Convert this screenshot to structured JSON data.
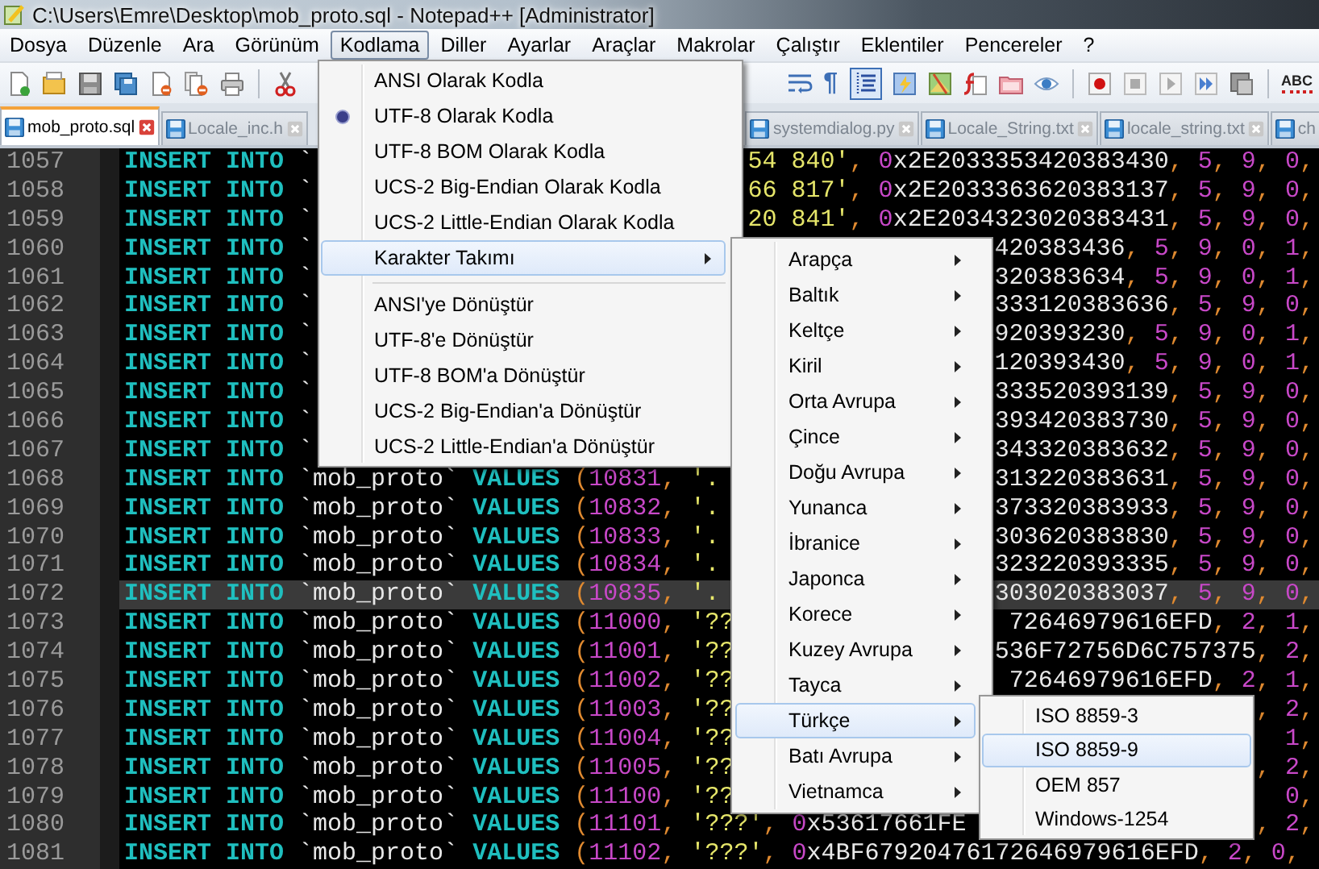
{
  "window": {
    "title": "C:\\Users\\Emre\\Desktop\\mob_proto.sql - Notepad++ [Administrator]"
  },
  "menu_bar": [
    {
      "label": "Dosya",
      "selected": false
    },
    {
      "label": "Düzenle",
      "selected": false
    },
    {
      "label": "Ara",
      "selected": false
    },
    {
      "label": "Görünüm",
      "selected": false
    },
    {
      "label": "Kodlama",
      "selected": true
    },
    {
      "label": "Diller",
      "selected": false
    },
    {
      "label": "Ayarlar",
      "selected": false
    },
    {
      "label": "Araçlar",
      "selected": false
    },
    {
      "label": "Makrolar",
      "selected": false
    },
    {
      "label": "Çalıştır",
      "selected": false
    },
    {
      "label": "Eklentiler",
      "selected": false
    },
    {
      "label": "Pencereler",
      "selected": false
    },
    {
      "label": "?",
      "selected": false
    }
  ],
  "toolbar": {
    "show_all_characters": {
      "glyph": "¶"
    },
    "indent_guide": {
      "pressed": true
    },
    "spell_check": {
      "label": "ABC"
    }
  },
  "tabs_left": [
    {
      "label": "mob_proto.sql",
      "selected": true,
      "cut_off": false
    },
    {
      "label": "Locale_inc.h",
      "selected": false,
      "cut_off": false
    }
  ],
  "tabs_right": [
    {
      "label": "systemdialog.py",
      "selected": false,
      "cut_off": false
    },
    {
      "label": "Locale_String.txt",
      "selected": false,
      "cut_off": false
    },
    {
      "label": "locale_string.txt",
      "selected": false,
      "cut_off": false
    },
    {
      "label": "ch",
      "selected": false,
      "cut_off": true
    }
  ],
  "editor": {
    "lines": [
      {
        "number": "1057",
        "current": false,
        "left": [
          {
            "kind": "kw",
            "t": "INSERT INTO"
          },
          {
            "kind": "id",
            "t": " `"
          }
        ],
        "right": [
          {
            "kind": "str",
            "t": "54 840'"
          },
          {
            "kind": "list",
            "t": ", "
          },
          {
            "kind": "hex",
            "t": "0x2E2033353420383430"
          },
          {
            "kind": "list",
            "t": ", 5, 9, 0,"
          }
        ]
      },
      {
        "number": "1058",
        "current": false,
        "left": [
          {
            "kind": "kw",
            "t": "INSERT INTO"
          },
          {
            "kind": "id",
            "t": " `"
          }
        ],
        "right": [
          {
            "kind": "str",
            "t": "66 817'"
          },
          {
            "kind": "list",
            "t": ", "
          },
          {
            "kind": "hex",
            "t": "0x2E2033363620383137"
          },
          {
            "kind": "list",
            "t": ", 5, 9, 0,"
          }
        ]
      },
      {
        "number": "1059",
        "current": false,
        "left": [
          {
            "kind": "kw",
            "t": "INSERT INTO"
          },
          {
            "kind": "id",
            "t": " `"
          }
        ],
        "right": [
          {
            "kind": "str",
            "t": "20 841'"
          },
          {
            "kind": "list",
            "t": ", "
          },
          {
            "kind": "hex",
            "t": "0x2E2034323020383431"
          },
          {
            "kind": "list",
            "t": ", 5, 9, 0,"
          }
        ]
      },
      {
        "number": "1060",
        "current": false,
        "left": [
          {
            "kind": "kw",
            "t": "INSERT INTO"
          },
          {
            "kind": "id",
            "t": " `"
          }
        ],
        "right": [
          {
            "kind": "id",
            "t": "420383436"
          },
          {
            "kind": "list",
            "t": ", 5, 9, 0, 1,"
          }
        ]
      },
      {
        "number": "1061",
        "current": false,
        "left": [
          {
            "kind": "kw",
            "t": "INSERT INTO"
          },
          {
            "kind": "id",
            "t": " `"
          }
        ],
        "right": [
          {
            "kind": "id",
            "t": "320383634"
          },
          {
            "kind": "list",
            "t": ", 5, 9, 0, 1,"
          }
        ]
      },
      {
        "number": "1062",
        "current": false,
        "left": [
          {
            "kind": "kw",
            "t": "INSERT INTO"
          },
          {
            "kind": "id",
            "t": " `"
          }
        ],
        "right": [
          {
            "kind": "id",
            "t": "333120383636"
          },
          {
            "kind": "list",
            "t": ", 5, 9, 0,"
          }
        ]
      },
      {
        "number": "1063",
        "current": false,
        "left": [
          {
            "kind": "kw",
            "t": "INSERT INTO"
          },
          {
            "kind": "id",
            "t": " `"
          }
        ],
        "right": [
          {
            "kind": "id",
            "t": "920393230"
          },
          {
            "kind": "list",
            "t": ", 5, 9, 0, 1,"
          }
        ]
      },
      {
        "number": "1064",
        "current": false,
        "left": [
          {
            "kind": "kw",
            "t": "INSERT INTO"
          },
          {
            "kind": "id",
            "t": " `"
          }
        ],
        "right": [
          {
            "kind": "id",
            "t": "120393430"
          },
          {
            "kind": "list",
            "t": ", 5, 9, 0, 1,"
          }
        ]
      },
      {
        "number": "1065",
        "current": false,
        "left": [
          {
            "kind": "kw",
            "t": "INSERT INTO"
          },
          {
            "kind": "id",
            "t": " `"
          }
        ],
        "right": [
          {
            "kind": "id",
            "t": "333520393139"
          },
          {
            "kind": "list",
            "t": ", 5, 9, 0,"
          }
        ]
      },
      {
        "number": "1066",
        "current": false,
        "left": [
          {
            "kind": "kw",
            "t": "INSERT INTO"
          },
          {
            "kind": "id",
            "t": " `"
          }
        ],
        "right": [
          {
            "kind": "id",
            "t": "393420383730"
          },
          {
            "kind": "list",
            "t": ", 5, 9, 0,"
          }
        ]
      },
      {
        "number": "1067",
        "current": false,
        "left": [
          {
            "kind": "kw",
            "t": "INSERT INTO"
          },
          {
            "kind": "id",
            "t": " `"
          }
        ],
        "right": [
          {
            "kind": "id",
            "t": "343320383632"
          },
          {
            "kind": "list",
            "t": ", 5, 9, 0,"
          }
        ]
      },
      {
        "number": "1068",
        "current": false,
        "left": [
          {
            "kind": "kw",
            "t": "INSERT INTO"
          },
          {
            "kind": "id",
            "t": " `mob_proto` "
          },
          {
            "kind": "kw",
            "t": "VALUES"
          },
          {
            "kind": "list",
            "t": " (10831, "
          },
          {
            "kind": "str",
            "t": "'."
          }
        ],
        "right": [
          {
            "kind": "id",
            "t": "313220383631"
          },
          {
            "kind": "list",
            "t": ", 5, 9, 0,"
          }
        ]
      },
      {
        "number": "1069",
        "current": false,
        "left": [
          {
            "kind": "kw",
            "t": "INSERT INTO"
          },
          {
            "kind": "id",
            "t": " `mob_proto` "
          },
          {
            "kind": "kw",
            "t": "VALUES"
          },
          {
            "kind": "list",
            "t": " (10832, "
          },
          {
            "kind": "str",
            "t": "'."
          }
        ],
        "right": [
          {
            "kind": "id",
            "t": "373320383933"
          },
          {
            "kind": "list",
            "t": ", 5, 9, 0,"
          }
        ]
      },
      {
        "number": "1070",
        "current": false,
        "left": [
          {
            "kind": "kw",
            "t": "INSERT INTO"
          },
          {
            "kind": "id",
            "t": " `mob_proto` "
          },
          {
            "kind": "kw",
            "t": "VALUES"
          },
          {
            "kind": "list",
            "t": " (10833, "
          },
          {
            "kind": "str",
            "t": "'."
          }
        ],
        "right": [
          {
            "kind": "id",
            "t": "303620383830"
          },
          {
            "kind": "list",
            "t": ", 5, 9, 0,"
          }
        ]
      },
      {
        "number": "1071",
        "current": false,
        "left": [
          {
            "kind": "kw",
            "t": "INSERT INTO"
          },
          {
            "kind": "id",
            "t": " `mob_proto` "
          },
          {
            "kind": "kw",
            "t": "VALUES"
          },
          {
            "kind": "list",
            "t": " (10834, "
          },
          {
            "kind": "str",
            "t": "'."
          }
        ],
        "right": [
          {
            "kind": "id",
            "t": "323220393335"
          },
          {
            "kind": "list",
            "t": ", 5, 9, 0,"
          }
        ]
      },
      {
        "number": "1072",
        "current": true,
        "left": [
          {
            "kind": "kw",
            "t": "INSERT INTO"
          },
          {
            "kind": "id",
            "t": " `mob_proto` "
          },
          {
            "kind": "kw",
            "t": "VALUES"
          },
          {
            "kind": "list",
            "t": " (10835, "
          },
          {
            "kind": "str",
            "t": "'."
          }
        ],
        "right": [
          {
            "kind": "id",
            "t": "303020383037"
          },
          {
            "kind": "list",
            "t": ", 5, 9, 0,"
          }
        ]
      },
      {
        "number": "1073",
        "current": false,
        "left": [
          {
            "kind": "kw",
            "t": "INSERT INTO"
          },
          {
            "kind": "id",
            "t": " `mob_proto` "
          },
          {
            "kind": "kw",
            "t": "VALUES"
          },
          {
            "kind": "list",
            "t": " (11000, "
          },
          {
            "kind": "str",
            "t": "'??"
          }
        ],
        "right": [
          {
            "kind": "id",
            "t": "72646979616EFD"
          },
          {
            "kind": "list",
            "t": ", 2, 1,"
          }
        ]
      },
      {
        "number": "1074",
        "current": false,
        "left": [
          {
            "kind": "kw",
            "t": "INSERT INTO"
          },
          {
            "kind": "id",
            "t": " `mob_proto` "
          },
          {
            "kind": "kw",
            "t": "VALUES"
          },
          {
            "kind": "list",
            "t": " (11001, "
          },
          {
            "kind": "str",
            "t": "'??"
          }
        ],
        "right": [
          {
            "kind": "id",
            "t": "536F72756D6C757375"
          },
          {
            "kind": "list",
            "t": ", 2,"
          }
        ]
      },
      {
        "number": "1075",
        "current": false,
        "left": [
          {
            "kind": "kw",
            "t": "INSERT INTO"
          },
          {
            "kind": "id",
            "t": " `mob_proto` "
          },
          {
            "kind": "kw",
            "t": "VALUES"
          },
          {
            "kind": "list",
            "t": " (11002, "
          },
          {
            "kind": "str",
            "t": "'??"
          }
        ],
        "right": [
          {
            "kind": "id",
            "t": "72646979616EFD"
          },
          {
            "kind": "list",
            "t": ", 2, 1,"
          }
        ]
      },
      {
        "number": "1076",
        "current": false,
        "left": [
          {
            "kind": "kw",
            "t": "INSERT INTO"
          },
          {
            "kind": "id",
            "t": " `mob_proto` "
          },
          {
            "kind": "kw",
            "t": "VALUES"
          },
          {
            "kind": "list",
            "t": " (11003, "
          },
          {
            "kind": "str",
            "t": "'??"
          }
        ],
        "right": [
          {
            "kind": "list",
            "t": ", 2,"
          }
        ]
      },
      {
        "number": "1077",
        "current": false,
        "left": [
          {
            "kind": "kw",
            "t": "INSERT INTO"
          },
          {
            "kind": "id",
            "t": " `mob_proto` "
          },
          {
            "kind": "kw",
            "t": "VALUES"
          },
          {
            "kind": "list",
            "t": " (11004, "
          },
          {
            "kind": "str",
            "t": "'??"
          }
        ],
        "right": [
          {
            "kind": "list",
            "t": "1,"
          }
        ]
      },
      {
        "number": "1078",
        "current": false,
        "left": [
          {
            "kind": "kw",
            "t": "INSERT INTO"
          },
          {
            "kind": "id",
            "t": " `mob_proto` "
          },
          {
            "kind": "kw",
            "t": "VALUES"
          },
          {
            "kind": "list",
            "t": " (11005, "
          },
          {
            "kind": "str",
            "t": "'??"
          }
        ],
        "right": [
          {
            "kind": "list",
            "t": ", 2,"
          }
        ]
      },
      {
        "number": "1079",
        "current": false,
        "left": [
          {
            "kind": "kw",
            "t": "INSERT INTO"
          },
          {
            "kind": "id",
            "t": " `mob_proto` "
          },
          {
            "kind": "kw",
            "t": "VALUES"
          },
          {
            "kind": "list",
            "t": " (11100, "
          },
          {
            "kind": "str",
            "t": "'??"
          }
        ],
        "right": [
          {
            "kind": "list",
            "t": "0,"
          }
        ]
      },
      {
        "number": "1080",
        "current": false,
        "left": [
          {
            "kind": "kw",
            "t": "INSERT INTO"
          },
          {
            "kind": "id",
            "t": " `mob_proto` "
          },
          {
            "kind": "kw",
            "t": "VALUES"
          },
          {
            "kind": "list",
            "t": " (11101, "
          },
          {
            "kind": "str",
            "t": "'???'"
          },
          {
            "kind": "list",
            "t": ", "
          },
          {
            "kind": "hex",
            "t": "0x53617661FE"
          }
        ],
        "right": [
          {
            "kind": "list",
            "t": ", 2,"
          }
        ]
      },
      {
        "number": "1081",
        "current": false,
        "left": [
          {
            "kind": "kw",
            "t": "INSERT INTO"
          },
          {
            "kind": "id",
            "t": " `mob_proto` "
          },
          {
            "kind": "kw",
            "t": "VALUES"
          },
          {
            "kind": "list",
            "t": " (11102, "
          },
          {
            "kind": "str",
            "t": "'???'"
          },
          {
            "kind": "list",
            "t": ", "
          },
          {
            "kind": "hex",
            "t": "0x4BF67920476172646979616EFD"
          },
          {
            "kind": "list",
            "t": ", 2, 0,"
          }
        ]
      }
    ]
  },
  "encoding_menu": {
    "items": [
      {
        "kind": "item",
        "label": "ANSI Olarak Kodla",
        "checked": false,
        "highlighted": false
      },
      {
        "kind": "item",
        "label": "UTF-8 Olarak Kodla",
        "checked": true,
        "highlighted": false
      },
      {
        "kind": "item",
        "label": "UTF-8 BOM Olarak Kodla",
        "checked": false,
        "highlighted": false
      },
      {
        "kind": "item",
        "label": "UCS-2 Big-Endian Olarak Kodla",
        "checked": false,
        "highlighted": false
      },
      {
        "kind": "item",
        "label": "UCS-2 Little-Endian Olarak Kodla",
        "checked": false,
        "highlighted": false
      },
      {
        "kind": "submenu",
        "label": "Karakter Takımı",
        "checked": false,
        "highlighted": true
      },
      {
        "kind": "separator"
      },
      {
        "kind": "item",
        "label": "ANSI'ye Dönüştür",
        "checked": false,
        "highlighted": false
      },
      {
        "kind": "item",
        "label": "UTF-8'e Dönüştür",
        "checked": false,
        "highlighted": false
      },
      {
        "kind": "item",
        "label": "UTF-8 BOM'a Dönüştür",
        "checked": false,
        "highlighted": false
      },
      {
        "kind": "item",
        "label": "UCS-2 Big-Endian'a Dönüştür",
        "checked": false,
        "highlighted": false
      },
      {
        "kind": "item",
        "label": "UCS-2 Little-Endian'a Dönüştür",
        "checked": false,
        "highlighted": false
      }
    ]
  },
  "charset_submenu": {
    "items": [
      {
        "label": "Arapça",
        "highlighted": false
      },
      {
        "label": "Baltık",
        "highlighted": false
      },
      {
        "label": "Keltçe",
        "highlighted": false
      },
      {
        "label": "Kiril",
        "highlighted": false
      },
      {
        "label": "Orta Avrupa",
        "highlighted": false
      },
      {
        "label": "Çince",
        "highlighted": false
      },
      {
        "label": "Doğu Avrupa",
        "highlighted": false
      },
      {
        "label": "Yunanca",
        "highlighted": false
      },
      {
        "label": "İbranice",
        "highlighted": false
      },
      {
        "label": "Japonca",
        "highlighted": false
      },
      {
        "label": "Korece",
        "highlighted": false
      },
      {
        "label": "Kuzey Avrupa",
        "highlighted": false
      },
      {
        "label": "Tayca",
        "highlighted": false
      },
      {
        "label": "Türkçe",
        "highlighted": true
      },
      {
        "label": "Batı Avrupa",
        "highlighted": false
      },
      {
        "label": "Vietnamca",
        "highlighted": false
      }
    ]
  },
  "turkish_submenu": {
    "items": [
      {
        "label": "ISO 8859-3",
        "highlighted": false
      },
      {
        "label": "ISO 8859-9",
        "highlighted": true
      },
      {
        "label": "OEM 857",
        "highlighted": false
      },
      {
        "label": "Windows-1254",
        "highlighted": false
      }
    ]
  }
}
